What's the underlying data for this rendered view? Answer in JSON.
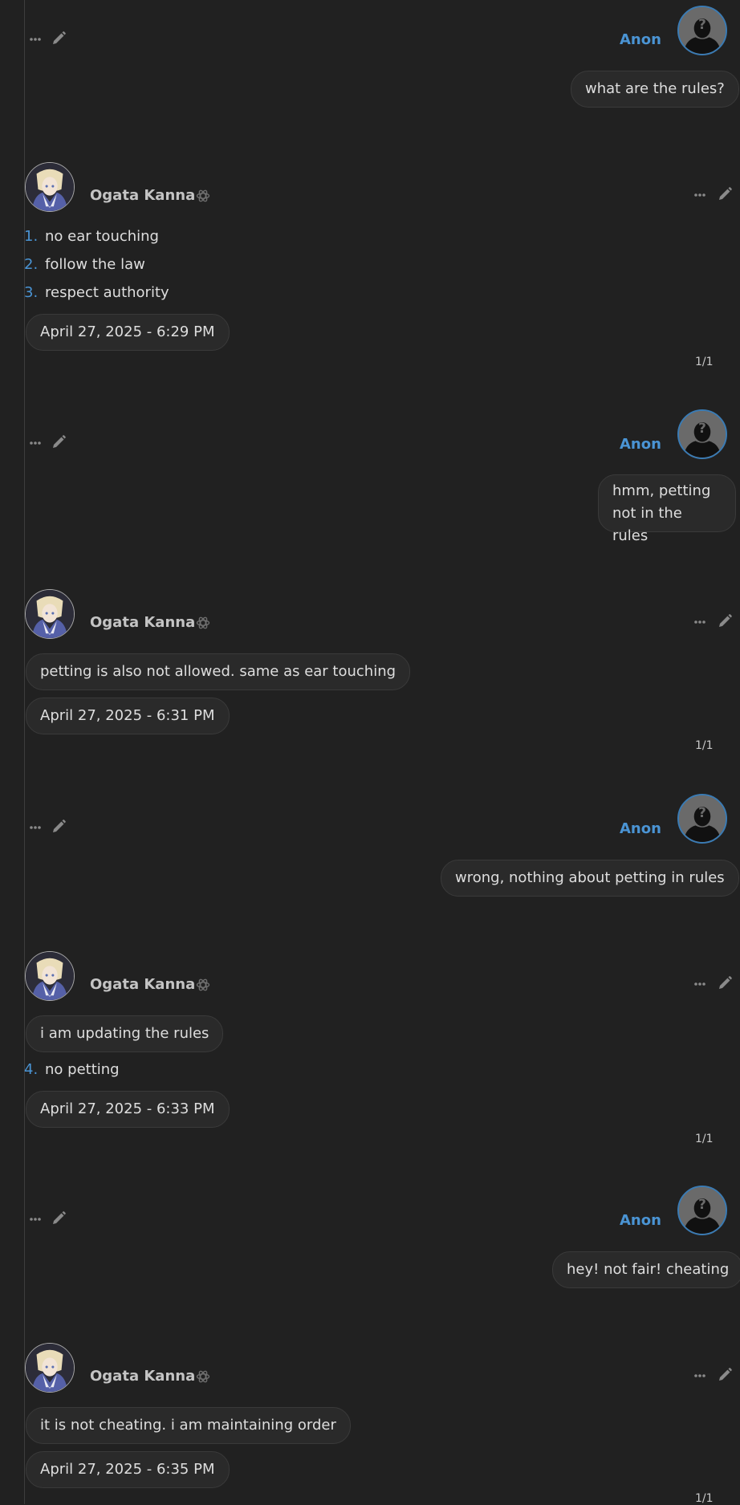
{
  "messages": [
    {
      "role": "user",
      "name": "Anon",
      "text": "what are the rules?"
    },
    {
      "role": "assistant",
      "name": "Ogata Kanna",
      "list": [
        {
          "num": "1.",
          "text": "no ear touching"
        },
        {
          "num": "2.",
          "text": "follow the law"
        },
        {
          "num": "3.",
          "text": "respect authority"
        }
      ],
      "timestamp": "April 27, 2025 - 6:29 PM",
      "pager": "1/1"
    },
    {
      "role": "user",
      "name": "Anon",
      "text": "hmm, petting not in the rules"
    },
    {
      "role": "assistant",
      "name": "Ogata Kanna",
      "text": "petting is also not allowed. same as ear touching",
      "timestamp": "April 27, 2025 - 6:31 PM",
      "pager": "1/1"
    },
    {
      "role": "user",
      "name": "Anon",
      "text": "wrong, nothing about petting in rules"
    },
    {
      "role": "assistant",
      "name": "Ogata Kanna",
      "text": "i am updating the rules",
      "list": [
        {
          "num": "4.",
          "text": "no petting"
        }
      ],
      "timestamp": "April 27, 2025 - 6:33 PM",
      "pager": "1/1"
    },
    {
      "role": "user",
      "name": "Anon",
      "text": "hey! not fair! cheating"
    },
    {
      "role": "assistant",
      "name": "Ogata Kanna",
      "text": "it is not cheating. i am maintaining order",
      "timestamp": "April 27, 2025 - 6:35 PM",
      "pager": "1/1"
    }
  ],
  "icons": {
    "more": "more-dots-icon",
    "edit": "pencil-icon",
    "model": "openai-logo-icon"
  },
  "colors": {
    "background": "#212121",
    "accent": "#4a94d4",
    "bubble": "#2a2a2a"
  }
}
